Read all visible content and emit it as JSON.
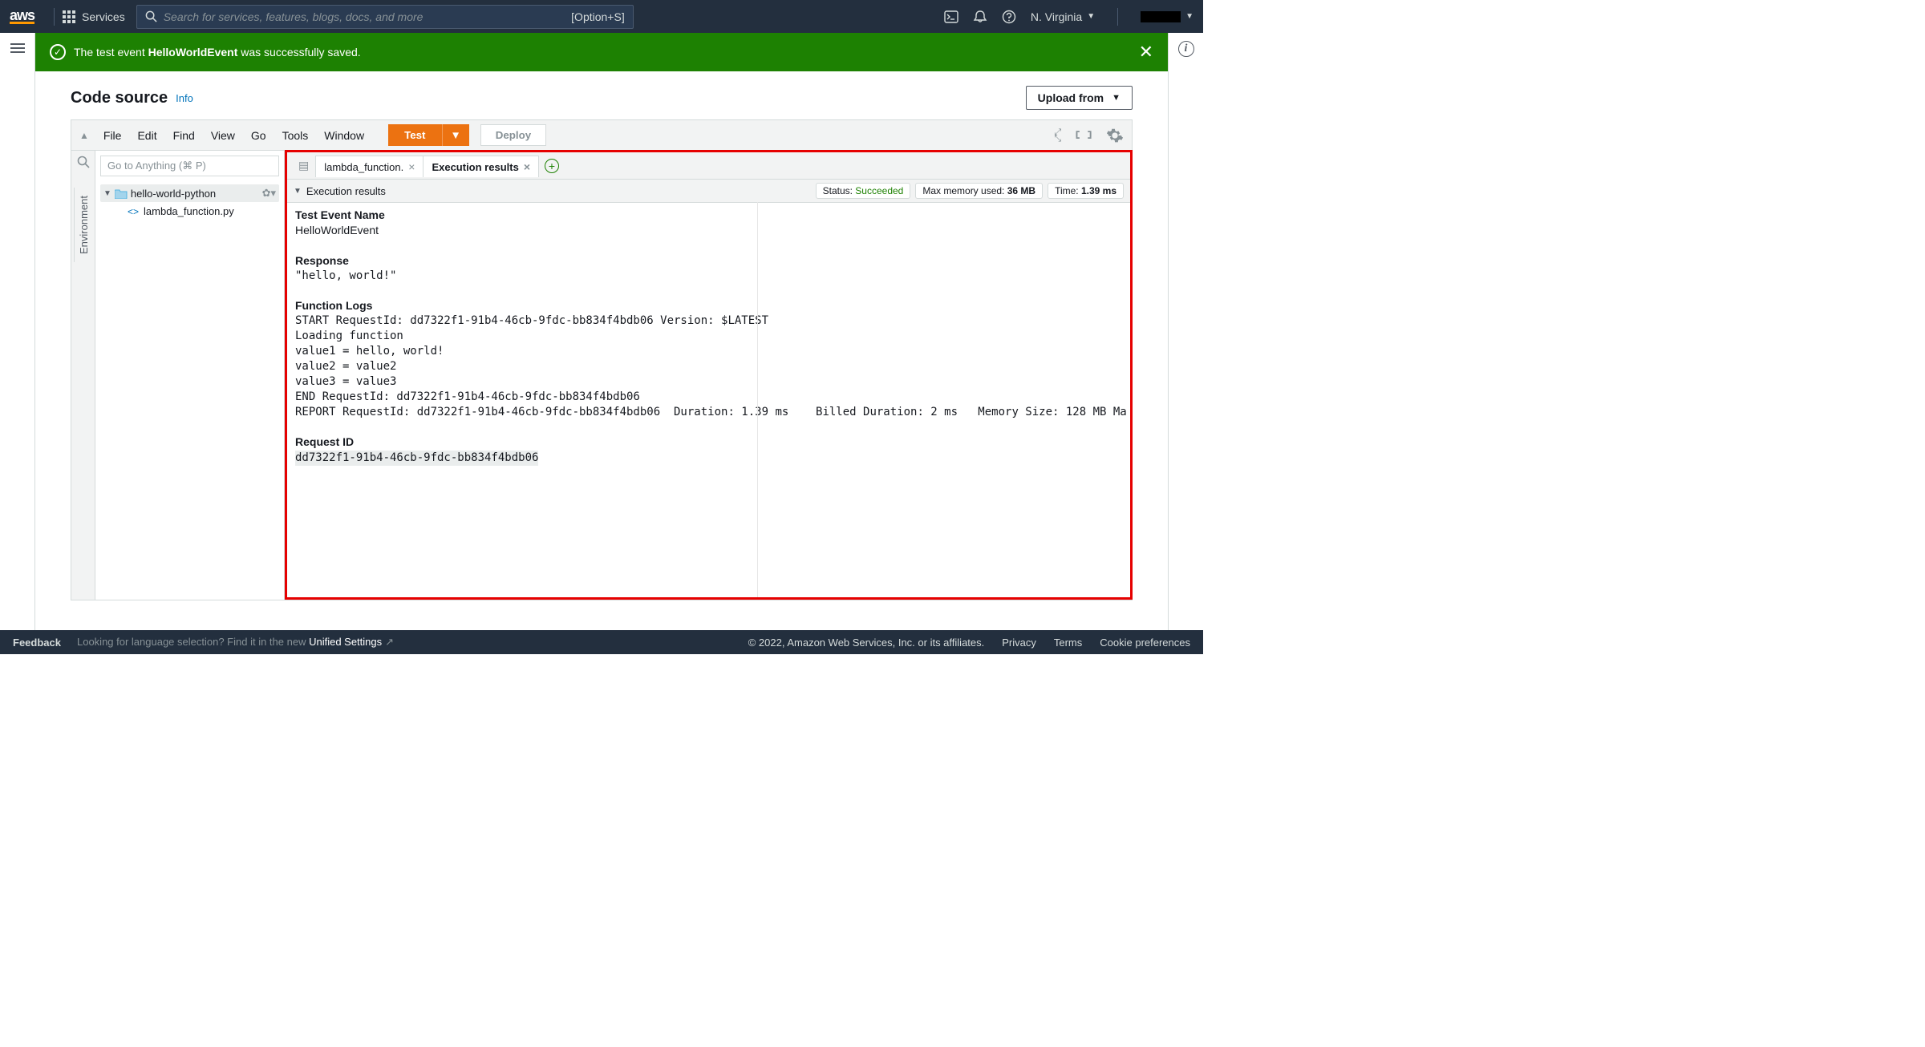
{
  "topnav": {
    "logo": "aws",
    "services": "Services",
    "search_placeholder": "Search for services, features, blogs, docs, and more",
    "search_shortcut": "[Option+S]",
    "region": "N. Virginia"
  },
  "banner": {
    "prefix": "The test event ",
    "event_name": "HelloWorldEvent",
    "suffix": " was successfully saved."
  },
  "panel": {
    "title": "Code source",
    "info": "Info",
    "upload": "Upload from"
  },
  "ide": {
    "menu": {
      "file": "File",
      "edit": "Edit",
      "find": "Find",
      "view": "View",
      "go": "Go",
      "tools": "Tools",
      "window": "Window"
    },
    "buttons": {
      "test": "Test",
      "deploy": "Deploy"
    },
    "goto_placeholder": "Go to Anything (⌘ P)",
    "env_label": "Environment",
    "tree": {
      "root": "hello-world-python",
      "file": "lambda_function.py"
    },
    "tabs": {
      "t1": "lambda_function.",
      "t2": "Execution results"
    },
    "exec_header": "Execution results",
    "pills": {
      "status_label": "Status: ",
      "status_value": "Succeeded",
      "mem_label": "Max memory used: ",
      "mem_value": "36 MB",
      "time_label": "Time: ",
      "time_value": "1.39 ms"
    },
    "result": {
      "test_event_label": "Test Event Name",
      "test_event_value": "HelloWorldEvent",
      "response_label": "Response",
      "response_value": "\"hello, world!\"",
      "logs_label": "Function Logs",
      "logs_body": "START RequestId: dd7322f1-91b4-46cb-9fdc-bb834f4bdb06 Version: $LATEST\nLoading function\nvalue1 = hello, world!\nvalue2 = value2\nvalue3 = value3\nEND RequestId: dd7322f1-91b4-46cb-9fdc-bb834f4bdb06\nREPORT RequestId: dd7322f1-91b4-46cb-9fdc-bb834f4bdb06  Duration: 1.39 ms    Billed Duration: 2 ms   Memory Size: 128 MB Ma",
      "reqid_label": "Request ID",
      "reqid_value": "dd7322f1-91b4-46cb-9fdc-bb834f4bdb06"
    }
  },
  "footer": {
    "feedback": "Feedback",
    "lang_prefix": "Looking for language selection? Find it in the new ",
    "lang_link": "Unified Settings",
    "copyright": "© 2022, Amazon Web Services, Inc. or its affiliates.",
    "privacy": "Privacy",
    "terms": "Terms",
    "cookie": "Cookie preferences"
  }
}
